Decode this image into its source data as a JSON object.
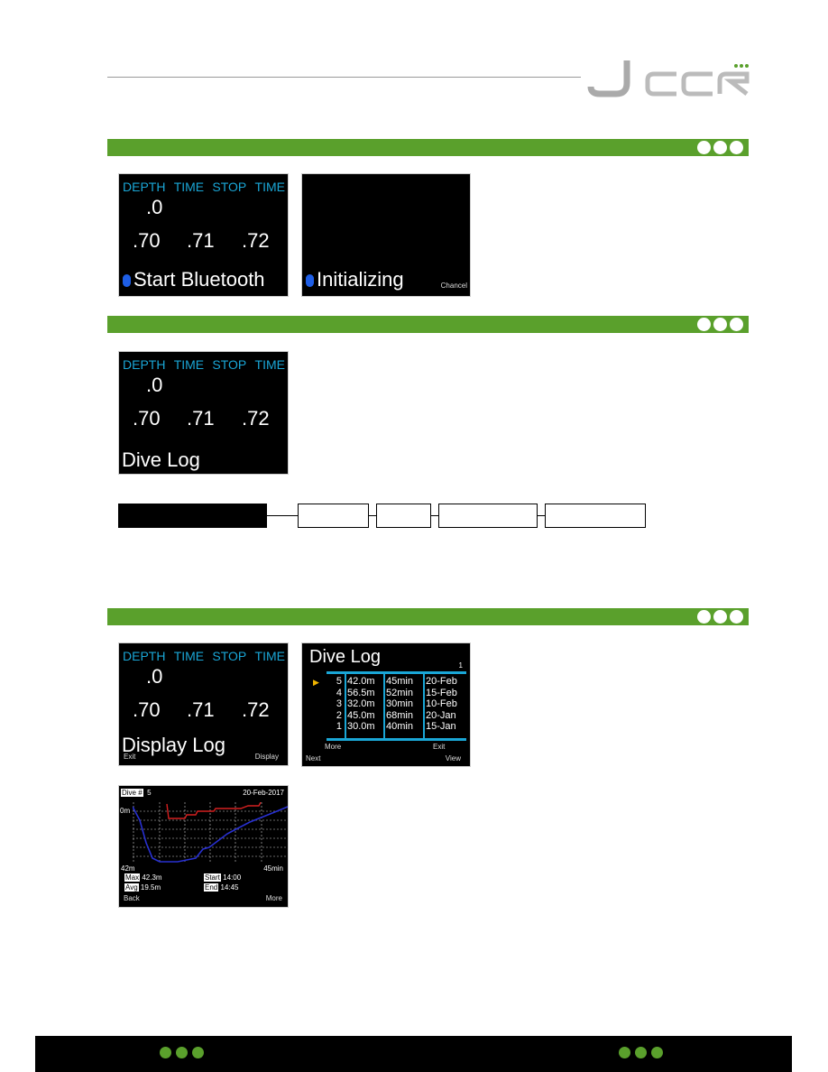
{
  "logo": {
    "text": "JCCR",
    "dot_color": "#5aa02c"
  },
  "colors": {
    "section_bar": "#5aa02c",
    "header_text": "#1aa6d6",
    "bluetooth": "#1e5ee6"
  },
  "screen_headers": [
    "DEPTH",
    "TIME",
    "STOP",
    "TIME"
  ],
  "screen_values": {
    "top": ".0",
    "row": [
      ".70",
      ".71",
      ".72"
    ]
  },
  "section1": {
    "screen1_label": "Start Bluetooth",
    "screen2_label": "Initializing",
    "screen2_softkey": "Chancel"
  },
  "section2": {
    "screen_label": "Dive Log"
  },
  "section3": {
    "screen1": {
      "label": "Display Log",
      "left_key": "Exit",
      "right_key": "Display"
    },
    "divelog": {
      "title": "Dive Log",
      "page": "1",
      "rows": [
        [
          "5",
          "42.0m",
          "45min",
          "20-Feb"
        ],
        [
          "4",
          "56.5m",
          "52min",
          "15-Feb"
        ],
        [
          "3",
          "32.0m",
          "30min",
          "10-Feb"
        ],
        [
          "2",
          "45.0m",
          "68min",
          "20-Jan"
        ],
        [
          "1",
          "30.0m",
          "40min",
          "15-Jan"
        ]
      ],
      "more": "More",
      "exit": "Exit",
      "next": "Next",
      "view": "View"
    },
    "graph": {
      "dive_label": "Dive #",
      "dive_no": "5",
      "date": "20-Feb-2017",
      "top_depth": "0m",
      "max_depth_axis": "42m",
      "duration": "45min",
      "max_label": "Max",
      "max": "42.3m",
      "avg_label": "Avg",
      "avg": "19.5m",
      "start_label": "Start",
      "start": "14:00",
      "end_label": "End",
      "end": "14:45",
      "back": "Back",
      "more": "More"
    }
  }
}
